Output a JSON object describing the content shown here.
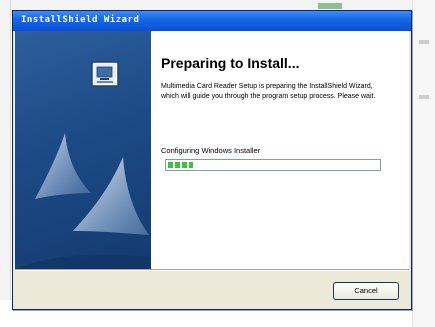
{
  "window": {
    "title": "InstallShield Wizard"
  },
  "wizard": {
    "heading": "Preparing to Install...",
    "description": "Multimedia Card Reader Setup is preparing the InstallShield Wizard, which will guide you through the program setup process. Please wait.",
    "status_text": "Configuring Windows Installer",
    "progress_percent": 12,
    "icon": "computer-setup-icon"
  },
  "buttons": {
    "cancel_label": "Cancel"
  },
  "colors": {
    "titlebar": "#1566e6",
    "side_panel": "#1d4a86",
    "progress": "#3fc13f",
    "dialog_face": "#ece9d8"
  }
}
